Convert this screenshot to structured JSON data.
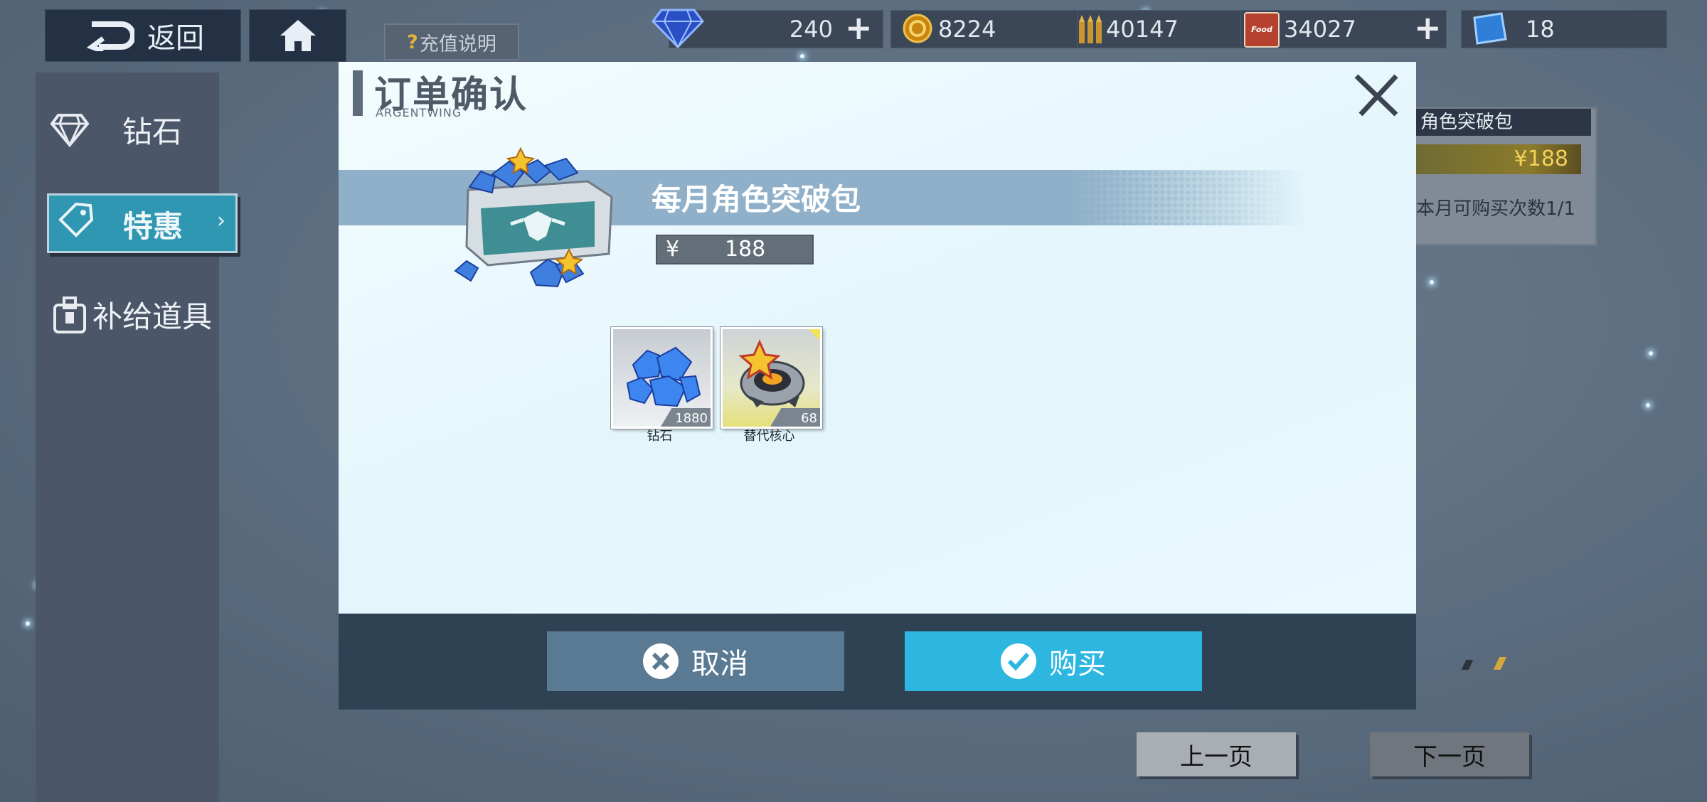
{
  "top_bar": {
    "back_label": "返回",
    "help_label": "充值说明",
    "help_prefix": "?",
    "resources": [
      {
        "icon": "diamond-icon",
        "value": "240",
        "has_plus": true
      },
      {
        "icon": "gold-coin-icon",
        "value": "8224",
        "has_plus": false
      },
      {
        "icon": "ammo-icon",
        "value": "40147",
        "has_plus": false
      },
      {
        "icon": "food-can-icon",
        "value": "34027",
        "has_plus": true
      },
      {
        "icon": "blue-ticket-icon",
        "value": "18",
        "has_plus": false
      }
    ],
    "food_can_text": "Food"
  },
  "sidebar": {
    "items": [
      {
        "label": "钻石",
        "icon": "diamond-outline-icon",
        "active": false
      },
      {
        "label": "特惠",
        "icon": "price-tag-icon",
        "active": true
      },
      {
        "label": "补给道具",
        "icon": "supply-box-icon",
        "active": false
      }
    ]
  },
  "background_card": {
    "title": "角色突破包",
    "price": "¥188",
    "limit": "本月可购买次数1/1"
  },
  "pagination": {
    "prev": "上一页",
    "next": "下一页"
  },
  "modal": {
    "title": "订单确认",
    "subtitle": "ARGENTWING",
    "package_name": "每月角色突破包",
    "currency": "¥",
    "price": "188",
    "items": [
      {
        "name": "钻石",
        "qty": "1880",
        "icon": "blue-crystals-icon"
      },
      {
        "name": "替代核心",
        "qty": "68",
        "icon": "star-core-icon"
      }
    ],
    "cancel_label": "取消",
    "buy_label": "购买"
  },
  "colors": {
    "accent_blue": "#2db6e0",
    "cancel_blue": "#5a7a94",
    "footer_dark": "#2f4254",
    "band_blue": "#8fb0c8",
    "active_tab": "#2f97b2",
    "gold_price": "#f4d25a"
  }
}
